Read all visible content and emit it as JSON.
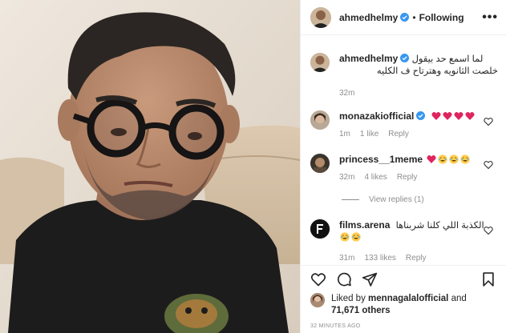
{
  "header": {
    "username": "ahmedhelmy",
    "separator": "•",
    "follow_status": "Following",
    "more_label": "•••"
  },
  "caption": {
    "username": "ahmedhelmy",
    "text_line1": "لما اسمع حد بيقول",
    "text_line2": "خلصت الثانويه وهترتاح ف الكليه",
    "time": "32m"
  },
  "comments": [
    {
      "username": "monazakiofficial",
      "text": "",
      "time": "1m",
      "likes": "1 like",
      "reply": "Reply"
    },
    {
      "username": "princess__1meme",
      "text": "",
      "time": "32m",
      "likes": "4 likes",
      "reply": "Reply"
    },
    {
      "username": "films.arena",
      "text": "الكذبة اللي كلنا شربناها",
      "time": "31m",
      "likes": "133 likes",
      "reply": "Reply"
    }
  ],
  "view_replies": "View replies (1)",
  "liked_by": {
    "prefix": "Liked by",
    "user": "mennagalalofficial",
    "conj": "and",
    "count": "71,671 others"
  },
  "time_ago": "32 MINUTES AGO",
  "colors": {
    "verified": "#3897f0",
    "heart": "#ed4956",
    "muted": "#8e8e8e",
    "text": "#262626"
  },
  "icons": [
    "verified-badge-icon",
    "heart-icon",
    "comment-icon",
    "share-icon",
    "bookmark-icon",
    "red-heart-emoji",
    "laughing-emoji"
  ]
}
